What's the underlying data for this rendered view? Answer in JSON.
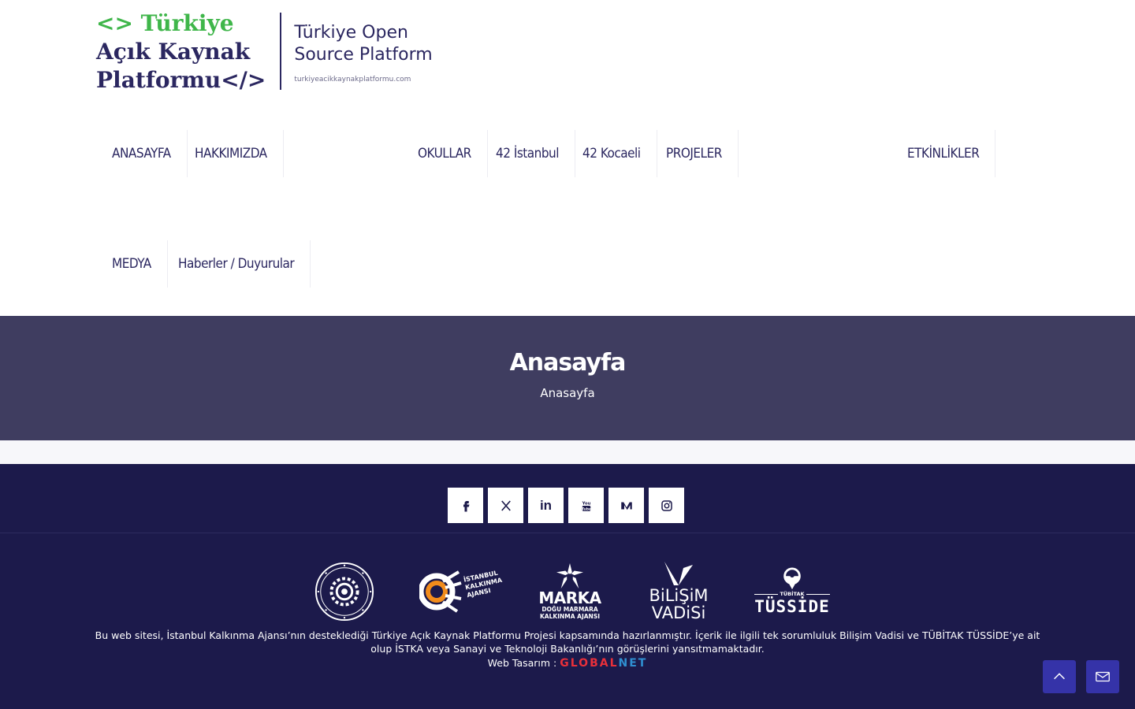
{
  "logo": {
    "tr_line1": "<> Türkiye",
    "tr_line2": "Açık Kaynak",
    "tr_line3": "Platformu</>",
    "en_line1": "Türkiye Open",
    "en_line2": "Source Platform",
    "url": "turkiyeacikkaynakplatformu.com"
  },
  "nav": {
    "items": [
      "ANASAYFA",
      "HAKKIMIZDA",
      "OKULLAR",
      "42 İstanbul",
      "42 Kocaeli",
      "PROJELER",
      "ETKİNLİKLER",
      "MEDYA",
      "Haberler / Duyurular"
    ]
  },
  "banner": {
    "title": "Anasayfa",
    "breadcrumb": "Anasayfa"
  },
  "social": {
    "icons": [
      "facebook-icon",
      "x-icon",
      "linkedin-icon",
      "youtube-icon",
      "medium-icon",
      "instagram-icon"
    ],
    "linkedin_label": "in",
    "youtube_label": "You Tube"
  },
  "partners": {
    "istka_text": "İSTANBUL KALKINMA AJANSI",
    "marka_title": "MARKA",
    "marka_sub1": "DOĞU MARMARA",
    "marka_sub2": "KALKINMA AJANSI",
    "bilisim_line1": "BiLiŞiM",
    "bilisim_line2": "VADiSi",
    "tubitak_small": "TÜBİTAK",
    "tubitak_big": "TÜSSİDE"
  },
  "footer": {
    "disclaimer": "Bu web sitesi, İstanbul Kalkınma Ajansı’nın desteklediği Türkiye Açık Kaynak Platformu Projesi kapsamında hazırlanmıştır. İçerik ile ilgili tek sorumluluk Bilişim Vadisi ve TÜBİTAK TÜSSİDE’ye ait olup İSTKA veya Sanayi ve Teknoloji Bakanlığı’nın görüşlerini yansıtmamaktadır.",
    "web_design_label": "Web Tasarım :",
    "designer_part1": "GLOBAL",
    "designer_part2": "NET"
  },
  "colors": {
    "brand_green": "#3fb64a",
    "brand_navy": "#2b2760",
    "banner_bg": "#3f3d60",
    "footer_bg": "#1c1a4b",
    "fab_bg": "#3533a8"
  }
}
